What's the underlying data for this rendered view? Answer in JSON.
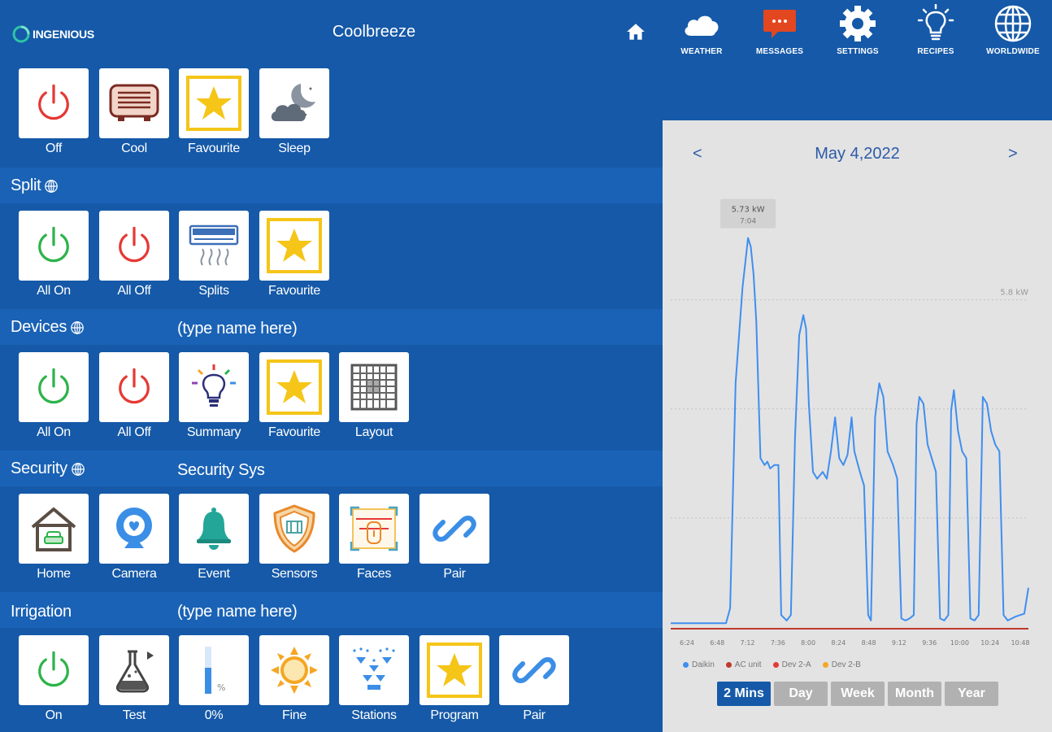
{
  "header": {
    "brand": "INGENIOUS",
    "title": "Coolbreeze",
    "nav": [
      {
        "label": "WEATHER",
        "icon": "cloud-icon"
      },
      {
        "label": "MESSAGES",
        "icon": "message-icon"
      },
      {
        "label": "SETTINGS",
        "icon": "gear-icon"
      },
      {
        "label": "RECIPES",
        "icon": "lightbulb-icon"
      },
      {
        "label": "WORLDWIDE",
        "icon": "globe-icon"
      }
    ]
  },
  "sections": {
    "top": {
      "tiles": [
        {
          "label": "Off",
          "icon": "power-icon"
        },
        {
          "label": "Cool",
          "icon": "heater-icon"
        },
        {
          "label": "Favourite",
          "icon": "star-icon"
        },
        {
          "label": "Sleep",
          "icon": "moon-cloud-icon"
        }
      ]
    },
    "split": {
      "title": "Split",
      "tiles": [
        {
          "label": "All On",
          "icon": "power-icon"
        },
        {
          "label": "All Off",
          "icon": "power-icon"
        },
        {
          "label": "Splits",
          "icon": "air-conditioner-icon"
        },
        {
          "label": "Favourite",
          "icon": "star-icon"
        }
      ]
    },
    "devices": {
      "title": "Devices",
      "subtitle": "(type name here)",
      "tiles": [
        {
          "label": "All On",
          "icon": "power-icon"
        },
        {
          "label": "All Off",
          "icon": "power-icon"
        },
        {
          "label": "Summary",
          "icon": "lightbulb-icon"
        },
        {
          "label": "Favourite",
          "icon": "star-icon"
        },
        {
          "label": "Layout",
          "icon": "grid-icon"
        }
      ]
    },
    "security": {
      "title": "Security",
      "subtitle": "Security Sys",
      "tiles": [
        {
          "label": "Home",
          "icon": "house-icon"
        },
        {
          "label": "Camera",
          "icon": "webcam-icon"
        },
        {
          "label": "Event",
          "icon": "bell-icon"
        },
        {
          "label": "Sensors",
          "icon": "shield-icon"
        },
        {
          "label": "Faces",
          "icon": "face-scan-icon"
        },
        {
          "label": "Pair",
          "icon": "link-icon"
        }
      ]
    },
    "irrigation": {
      "title": "Irrigation",
      "subtitle": "(type name here)",
      "tiles": [
        {
          "label": "On",
          "icon": "power-icon"
        },
        {
          "label": "Test",
          "icon": "flask-icon"
        },
        {
          "label": "0%",
          "icon": "gauge-icon"
        },
        {
          "label": "Fine",
          "icon": "sun-icon"
        },
        {
          "label": "Stations",
          "icon": "sprinkler-icon"
        },
        {
          "label": "Program",
          "icon": "star-icon"
        },
        {
          "label": "Pair",
          "icon": "link-icon"
        }
      ]
    }
  },
  "chart": {
    "date": "May 4,2022",
    "prev": "<",
    "next": ">",
    "tooltip_value": "5.73 kW",
    "tooltip_time": "7:04",
    "range": [
      "2 Mins",
      "Day",
      "Week",
      "Month",
      "Year"
    ],
    "active_range": "2 Mins"
  },
  "colors": {
    "background": "#1559a8",
    "power_green": "#2db34a",
    "power_red": "#e53935",
    "star_yellow": "#f5c518",
    "line_blue": "#3f8ef0",
    "baseline_red": "#c0392b"
  },
  "chart_data": {
    "type": "line",
    "title": "",
    "xlabel": "",
    "ylabel": "",
    "ylim": [
      0,
      6
    ],
    "y_max_label": "5.8 kW",
    "x_ticks": [
      "6:24",
      "6:48",
      "7:12",
      "7:36",
      "8:00",
      "8:24",
      "8:48",
      "9:12",
      "9:36",
      "10:00",
      "10:24",
      "10:48"
    ],
    "legend": [
      {
        "name": "Daikin",
        "color": "#3f8ef0"
      },
      {
        "name": "AC unit",
        "color": "#c0392b"
      },
      {
        "name": "Dev 2-A",
        "color": "#e53935"
      },
      {
        "name": "Dev 2-B",
        "color": "#f5a623"
      }
    ],
    "series": [
      {
        "name": "Daikin",
        "x_minutes": [
          0,
          10,
          20,
          30,
          40,
          43,
          47,
          52,
          56,
          58,
          60,
          62,
          65,
          68,
          70,
          72,
          75,
          78,
          80,
          84,
          87,
          90,
          93,
          96,
          98,
          100,
          103,
          106,
          110,
          113,
          116,
          119,
          122,
          125,
          128,
          131,
          133,
          135,
          137,
          140,
          143,
          145,
          148,
          151,
          154,
          157,
          159,
          161,
          164,
          167,
          170,
          173,
          176,
          178,
          180,
          183,
          186,
          189,
          192,
          195,
          198,
          201,
          203,
          205,
          208,
          211,
          214,
          217,
          220,
          223,
          226,
          229,
          232,
          235,
          238,
          241,
          244,
          247,
          250,
          253,
          256,
          259
        ],
        "values": [
          0.08,
          0.08,
          0.08,
          0.08,
          0.08,
          0.3,
          3.6,
          5.0,
          5.73,
          5.6,
          5.2,
          4.5,
          2.5,
          2.4,
          2.45,
          2.35,
          2.4,
          2.4,
          0.2,
          0.12,
          0.2,
          2.8,
          4.3,
          4.6,
          4.4,
          3.3,
          2.3,
          2.2,
          2.3,
          2.2,
          2.6,
          3.1,
          2.5,
          2.4,
          2.55,
          3.1,
          2.6,
          2.45,
          2.3,
          2.1,
          0.2,
          0.12,
          3.1,
          3.6,
          3.4,
          2.6,
          2.5,
          2.4,
          2.2,
          0.15,
          0.12,
          0.15,
          0.2,
          3.0,
          3.4,
          3.3,
          2.7,
          2.5,
          2.3,
          0.15,
          0.12,
          0.2,
          3.2,
          3.5,
          2.9,
          2.6,
          2.5,
          0.15,
          0.12,
          0.2,
          3.4,
          3.3,
          2.9,
          2.7,
          2.6,
          0.2,
          0.12,
          0.15,
          0.18,
          0.2,
          0.22,
          0.6
        ]
      },
      {
        "name": "AC unit",
        "x_minutes": [
          0,
          259
        ],
        "values": [
          0.0,
          0.0
        ]
      }
    ]
  }
}
